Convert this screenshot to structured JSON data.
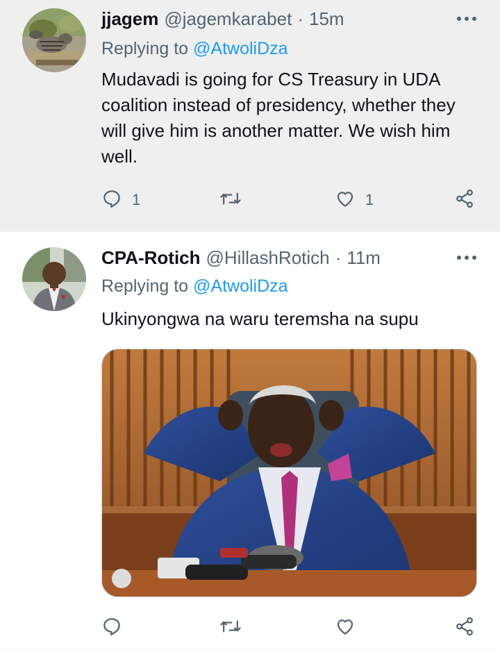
{
  "tweets": [
    {
      "name": "jjagem",
      "handle": "@jagemkarabet",
      "separator": "·",
      "time": "15m",
      "replying_prefix": "Replying to",
      "replying_to": "@AtwoliDza",
      "text": "Mudavadi is going for CS Treasury in UDA coalition instead of presidency, whether they will give him is another matter. We wish him well.",
      "reply_count": "1",
      "retweet_count": "",
      "like_count": "1"
    },
    {
      "name": "CPA-Rotich",
      "handle": "@HillashRotich",
      "separator": "·",
      "time": "11m",
      "replying_prefix": "Replying to",
      "replying_to": "@AtwoliDza",
      "text": "Ukinyongwa na waru teremsha na supu",
      "reply_count": "",
      "retweet_count": "",
      "like_count": ""
    }
  ],
  "icons": {
    "more": "more-icon",
    "reply": "reply-icon",
    "retweet": "retweet-icon",
    "like": "like-icon",
    "share": "share-icon"
  },
  "colors": {
    "link": "#1d9bf0",
    "secondary_text": "#536471",
    "primary_text": "#0f1419",
    "highlight_bg": "#efefef"
  }
}
